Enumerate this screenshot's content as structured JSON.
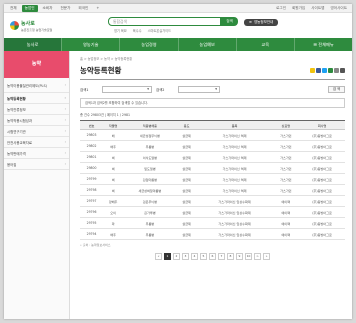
{
  "topbar": {
    "tabs": [
      "전체",
      "농업인",
      "소비자",
      "전문가",
      "외국인"
    ],
    "add_tab": "+",
    "utils": [
      "로그인",
      "회원가입",
      "사이트맵",
      "영어사이트"
    ]
  },
  "header": {
    "logo_text": "농사로",
    "logo_sub": "농촌진흥청 농업기술포털",
    "search_placeholder": "통합검색",
    "search_button": "검색",
    "keywords": [
      "영기 육묘",
      "육수수",
      "스마트온실가이드"
    ],
    "button_label": "영농정보안내"
  },
  "nav": {
    "items": [
      "농사로",
      "영농기술",
      "농업경영",
      "농업예보",
      "교육",
      "전체메뉴"
    ]
  },
  "sidebar": {
    "heading": "농약",
    "items": [
      {
        "label": "농약이용물질관리제도(PLS)",
        "tall": true
      },
      {
        "label": "농약등록현황",
        "active": true
      },
      {
        "label": "농약잔류정보"
      },
      {
        "label": "농약작용시험성과"
      },
      {
        "label": "시험연구기관"
      },
      {
        "label": "안전사용교육자료"
      },
      {
        "label": "농약판매가격"
      },
      {
        "label": "용어집"
      }
    ]
  },
  "main": {
    "breadcrumb": "홈 > 농업정보 > 농약 > 농약등록현황",
    "title": "농약등록현황",
    "filter1_label": "검색1",
    "filter1_value": "",
    "filter2_label": "검색2",
    "filter2_value": "",
    "search_button": "검 색",
    "notice": "검색1과 검색2를 조합하여 검색할 수 있습니다.",
    "count": "총 건수 29803건 | 페이지 1 / 2981",
    "table": {
      "headers": [
        "번호",
        "작물명",
        "적용병해충",
        "용도",
        "품목",
        "상표명",
        "회사명"
      ],
      "rows": [
        [
          "29803",
          "배",
          "세균성점무늬병",
          "살균제",
          "가스가마이신 액제",
          "가스가민",
          "(주)동방아그로"
        ],
        [
          "29802",
          "배추",
          "무름병",
          "살균제",
          "가스가마이신 액제",
          "가스가민",
          "(주)동방아그로"
        ],
        [
          "29801",
          "벼",
          "이삭도열병",
          "살균제",
          "가스가마이신 액제",
          "가스가민",
          "(주)동방아그로"
        ],
        [
          "29800",
          "벼",
          "잎도열병",
          "살균제",
          "가스가마이신 액제",
          "가스가민",
          "(주)동방아그로"
        ],
        [
          "29799",
          "벼",
          "흰잎마름병",
          "살균제",
          "가스가마이신 액제",
          "가스가민",
          "(주)동방아그로"
        ],
        [
          "29798",
          "벼",
          "세균성벼알마름병",
          "살균제",
          "가스가마이신 액제",
          "가스가민",
          "(주)동방아그로"
        ],
        [
          "29797",
          "양배추",
          "검은무늬병",
          "살균제",
          "가스가마이신 입상수화제",
          "에이팩",
          "(주)동방아그로"
        ],
        [
          "29796",
          "오이",
          "흰가루병",
          "살균제",
          "가스가마이신 입상수화제",
          "에이팩",
          "(주)동방아그로"
        ],
        [
          "29795",
          "파",
          "무름병",
          "살균제",
          "가스가마이신 입상수화제",
          "에이팩",
          "(주)동방아그로"
        ],
        [
          "29794",
          "배추",
          "무름병",
          "살균제",
          "가스가마이신 입상수화제",
          "에이팩",
          "(주)동방아그로"
        ]
      ]
    },
    "source": "• 출처 : 농약정보서비스",
    "pages": [
      "«",
      "1",
      "2",
      "3",
      "4",
      "5",
      "6",
      "7",
      "8",
      "9",
      "10",
      ">",
      "»"
    ]
  },
  "colors": {
    "brand": "#2e8b3e",
    "sidebar_head": "#e84c6c"
  }
}
